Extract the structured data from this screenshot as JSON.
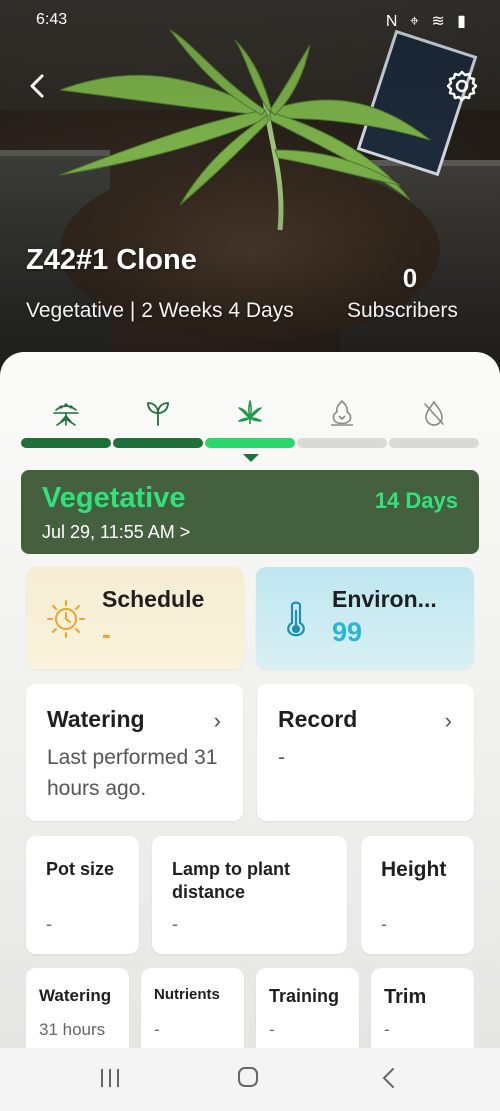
{
  "status_bar": {
    "time": "6:43",
    "right_icons": "N ⌖ ≋ ▮"
  },
  "header": {
    "plant_name": "Z42#1 Clone",
    "stage_line": "Vegetative | 2 Weeks 4 Days",
    "subscribers_count": "0",
    "subscribers_label": "Subscribers"
  },
  "stage_progress": {
    "icons": [
      "roots-icon",
      "seedling-icon",
      "cannabis-leaf-icon",
      "bud-icon",
      "no-water-drop-icon"
    ],
    "active_index": 2,
    "colors": {
      "done": "#1f6f3a",
      "active": "#2bd66a",
      "pending": "#d9d9d9"
    }
  },
  "stage_card": {
    "title": "Vegetative",
    "days": "14 Days",
    "date": "Jul 29, 11:55 AM >"
  },
  "schedule": {
    "title": "Schedule",
    "value": "-"
  },
  "environment": {
    "title": "Environ...",
    "value": "99"
  },
  "watering": {
    "title": "Watering",
    "chevron": "›",
    "subtitle": "Last performed 31 hours ago."
  },
  "record": {
    "title": "Record",
    "chevron": "›",
    "subtitle": "-"
  },
  "pot_size": {
    "title": "Pot size",
    "value": "-"
  },
  "lamp": {
    "title": "Lamp to plant distance",
    "value": "-"
  },
  "height": {
    "title": "Height",
    "value": "-"
  },
  "small_cards": [
    {
      "title": "Watering",
      "value": "31 hours"
    },
    {
      "title": "Nutrients",
      "value": "-"
    },
    {
      "title": "Training",
      "value": "-"
    },
    {
      "title": "Trim",
      "value": "-"
    }
  ]
}
